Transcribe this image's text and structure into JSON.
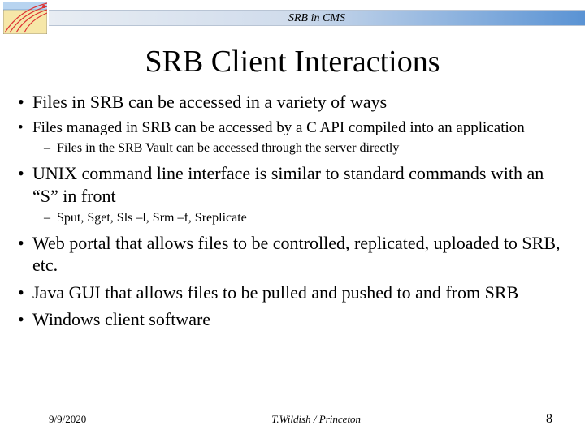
{
  "header": {
    "strip_title": "SRB in CMS"
  },
  "title": "SRB Client Interactions",
  "bullets": [
    {
      "text": "Files in SRB can be accessed in a variety of ways",
      "size": "large"
    },
    {
      "text": "Files managed in SRB can be accessed by a C API compiled into an application",
      "size": "small",
      "sub": [
        "Files in the SRB Vault can be accessed through the server directly"
      ]
    },
    {
      "text": "UNIX command line interface is similar to standard commands with an “S” in front",
      "size": "large",
      "sub": [
        "Sput, Sget, Sls –l, Srm –f, Sreplicate"
      ]
    },
    {
      "text": "Web portal that allows files to be controlled, replicated, uploaded to SRB, etc.",
      "size": "large"
    },
    {
      "text": "Java GUI that allows files to be pulled and pushed to and from SRB",
      "size": "large"
    },
    {
      "text": "Windows client software",
      "size": "large"
    }
  ],
  "footer": {
    "date": "9/9/2020",
    "author": "T.Wildish / Princeton",
    "page": "8"
  }
}
